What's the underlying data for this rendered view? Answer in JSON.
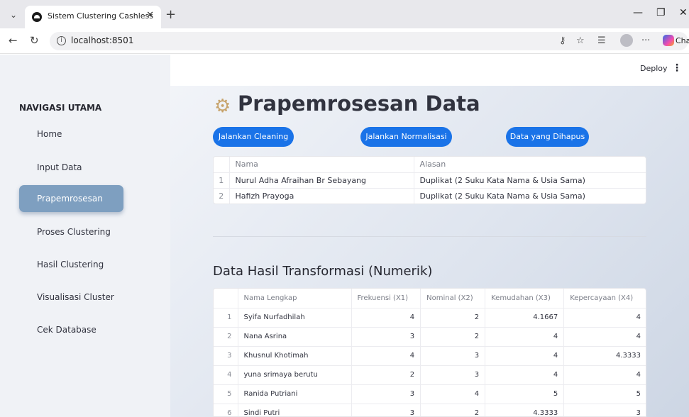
{
  "browser": {
    "tab_title": "Sistem Clustering Cashless",
    "url": "localhost:8501",
    "chat_label": "Chat"
  },
  "app": {
    "deploy_label": "Deploy",
    "sidebar": {
      "title": "NAVIGASI UTAMA",
      "items": [
        {
          "label": "Home",
          "active": false
        },
        {
          "label": "Input Data",
          "active": false
        },
        {
          "label": "Prapemrosesan",
          "active": true
        },
        {
          "label": "Proses Clustering",
          "active": false
        },
        {
          "label": "Hasil Clustering",
          "active": false
        },
        {
          "label": "Visualisasi Cluster",
          "active": false
        },
        {
          "label": "Cek Database",
          "active": false
        }
      ]
    },
    "page_title": "Prapemrosesan Data",
    "buttons": {
      "cleaning": "Jalankan Cleaning",
      "normalisasi": "Jalankan Normalisasi",
      "dihapus": "Data yang Dihapus"
    },
    "deleted_table": {
      "headers": [
        "Nama",
        "Alasan"
      ],
      "rows": [
        {
          "idx": "1",
          "nama": "Nurul Adha Afraihan Br Sebayang",
          "alasan": "Duplikat (2 Suku Kata Nama & Usia Sama)"
        },
        {
          "idx": "2",
          "nama": "Hafizh Prayoga",
          "alasan": "Duplikat (2 Suku Kata Nama & Usia Sama)"
        }
      ]
    },
    "section_title": "Data Hasil Transformasi (Numerik)",
    "transform_table": {
      "headers": [
        "Nama Lengkap",
        "Frekuensi (X1)",
        "Nominal (X2)",
        "Kemudahan (X3)",
        "Kepercayaan (X4)"
      ],
      "rows": [
        {
          "idx": "1",
          "nama": "Syifa Nurfadhilah",
          "x1": "4",
          "x2": "2",
          "x3": "4.1667",
          "x4": "4"
        },
        {
          "idx": "2",
          "nama": "Nana Asrina",
          "x1": "3",
          "x2": "2",
          "x3": "4",
          "x4": "4"
        },
        {
          "idx": "3",
          "nama": "Khusnul Khotimah",
          "x1": "4",
          "x2": "3",
          "x3": "4",
          "x4": "4.3333"
        },
        {
          "idx": "4",
          "nama": "yuna srimaya berutu",
          "x1": "2",
          "x2": "3",
          "x3": "4",
          "x4": "4"
        },
        {
          "idx": "5",
          "nama": "Ranida Putriani",
          "x1": "3",
          "x2": "4",
          "x3": "5",
          "x4": "5"
        },
        {
          "idx": "6",
          "nama": "Sindi Putri",
          "x1": "3",
          "x2": "2",
          "x3": "4.3333",
          "x4": "3"
        }
      ]
    }
  }
}
